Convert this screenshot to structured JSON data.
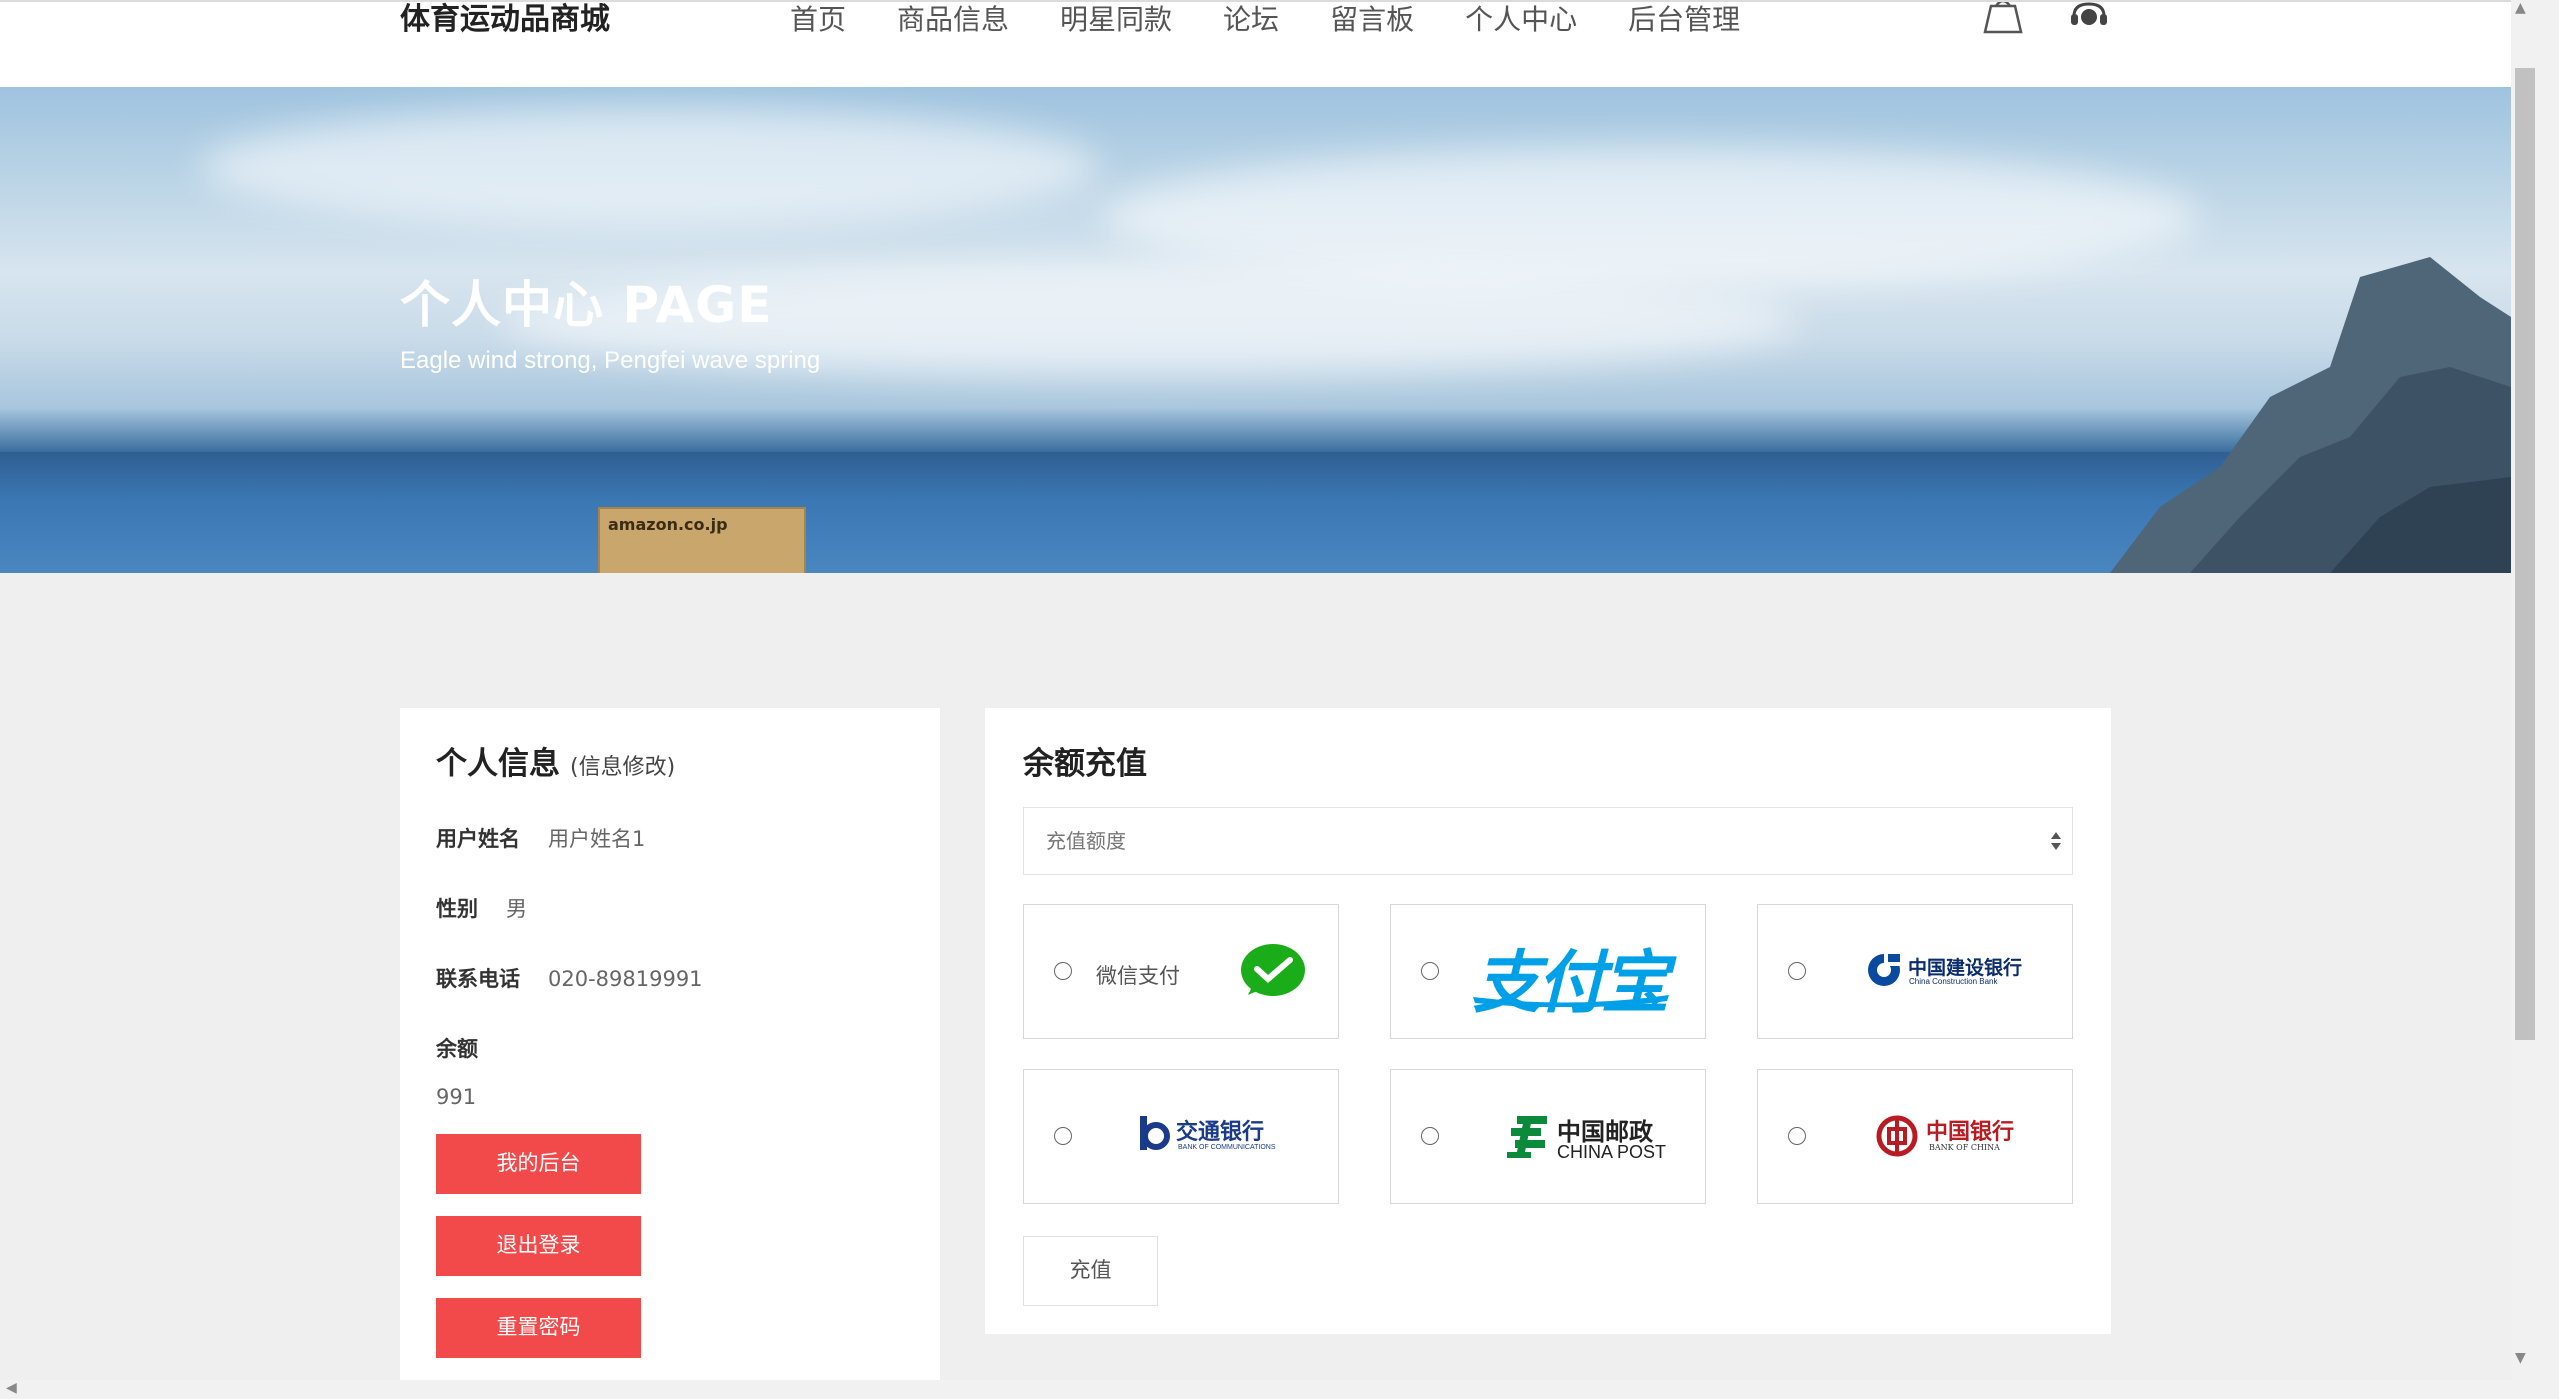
{
  "header": {
    "brand": "体育运动品商城",
    "nav": [
      "首页",
      "商品信息",
      "明星同款",
      "论坛",
      "留言板",
      "个人中心",
      "后台管理"
    ],
    "icons": [
      "shopping-bag-icon",
      "customer-service-icon"
    ]
  },
  "banner": {
    "title": "个人中心 PAGE",
    "subtitle": "Eagle wind strong, Pengfei wave spring",
    "box_label": "amazon.co.jp"
  },
  "profile": {
    "title": "个人信息",
    "edit_link": "(信息修改)",
    "fields": [
      {
        "label": "用户姓名",
        "value": "用户姓名1"
      },
      {
        "label": "性别",
        "value": "男"
      },
      {
        "label": "联系电话",
        "value": "020-89819991"
      }
    ],
    "balance_label": "余额",
    "balance_value": "991",
    "buttons": [
      "我的后台",
      "退出登录",
      "重置密码"
    ]
  },
  "recharge": {
    "title": "余额充值",
    "amount_placeholder": "充值额度",
    "payment_options": [
      {
        "name": "wechat-pay",
        "label": "微信支付"
      },
      {
        "name": "alipay",
        "logo_text": "支付宝"
      },
      {
        "name": "china-construction-bank",
        "logo_text": "中国建设银行",
        "logo_sub": "China Construction Bank"
      },
      {
        "name": "bank-of-communications",
        "logo_text": "交通银行",
        "logo_sub": "BANK OF COMMUNICATIONS"
      },
      {
        "name": "china-post",
        "logo_text": "中国邮政",
        "logo_sub": "CHINA POST"
      },
      {
        "name": "bank-of-china",
        "logo_text": "中国银行",
        "logo_sub": "BANK OF CHINA"
      }
    ],
    "submit_label": "充值"
  },
  "colors": {
    "accent_red": "#f24a4a",
    "wechat_green": "#1aad19",
    "alipay_blue": "#00a0e9"
  }
}
